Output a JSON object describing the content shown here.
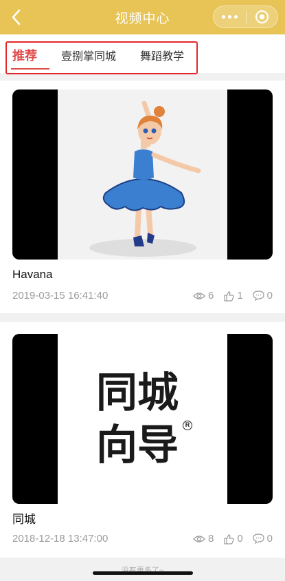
{
  "nav": {
    "title": "视频中心"
  },
  "tabs": [
    {
      "label": "推荐",
      "active": true
    },
    {
      "label": "壹捌掌同城",
      "active": false
    },
    {
      "label": "舞蹈教学",
      "active": false
    }
  ],
  "videos": [
    {
      "title": "Havana",
      "date": "2019-03-15 16:41:40",
      "views": "6",
      "likes": "1",
      "comments": "0"
    },
    {
      "title": "同城",
      "date": "2018-12-18 13:47:00",
      "views": "8",
      "likes": "0",
      "comments": "0",
      "logo_text": "同城向导"
    }
  ],
  "footer": {
    "text": "没有更多了~"
  },
  "colors": {
    "navbar": "#e7c455",
    "tab_active": "#e04a4a",
    "highlight_box": "#e2272b"
  }
}
